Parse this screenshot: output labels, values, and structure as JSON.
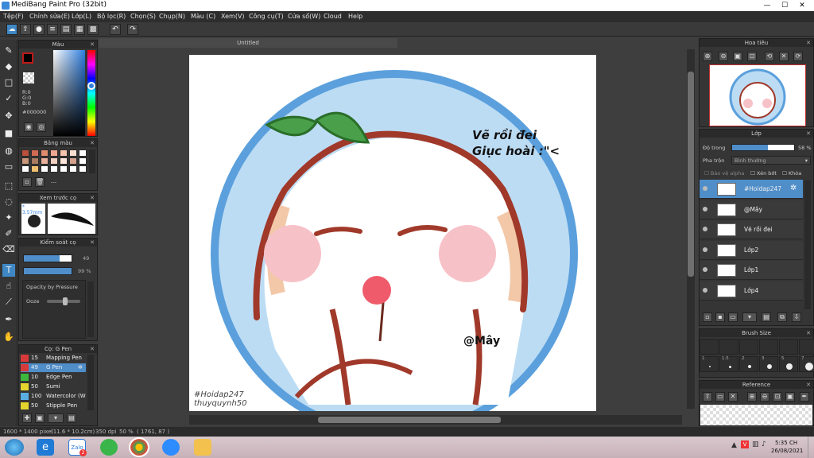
{
  "window": {
    "title": "MediBang Paint Pro (32bit)"
  },
  "menu": [
    "Tệp(F)",
    "Chỉnh sửa(E)",
    "Lớp(L)",
    "Bộ lọc(R)",
    "Chọn(S)",
    "Chụp(N)",
    "Màu (C)",
    "Xem(V)",
    "Công cụ(T)",
    "Cửa sổ(W)",
    "Cloud",
    "Help"
  ],
  "color_panel": {
    "title": "Màu",
    "r": "R:0",
    "g": "G:0",
    "b": "B:0",
    "hex": "#000000"
  },
  "palette_panel": {
    "title": "Bảng màu",
    "dashes": "---"
  },
  "preview_panel": {
    "title": "Xem trước cọ",
    "size": "* 3.57mm"
  },
  "brush_control": {
    "title": "Kiểm soát cọ",
    "size_value": "49",
    "opacity_value": "99 %",
    "pressure_label": "Opacity by Pressure",
    "ooze_label": "Ooze"
  },
  "brush_list": {
    "title": "Cọ: G Pen",
    "items": [
      {
        "size": "15",
        "name": "Mapping Pen",
        "color": "#d83a3a"
      },
      {
        "size": "49",
        "name": "G Pen",
        "color": "#d83a3a",
        "selected": true
      },
      {
        "size": "10",
        "name": "Edge Pen",
        "color": "#3db83d"
      },
      {
        "size": "50",
        "name": "Sumi",
        "color": "#e3d52e"
      },
      {
        "size": "100",
        "name": "Watercolor (W",
        "color": "#5aaee3"
      },
      {
        "size": "50",
        "name": "Stipple Pen",
        "color": "#e3d52e"
      }
    ]
  },
  "document": {
    "tab": "Untitled"
  },
  "artwork": {
    "text_main": [
      "Vẽ rồi đei",
      "Giục hoài :\"<"
    ],
    "signature": "@Mây",
    "watermark": [
      "#Hoidap247",
      "thuyquynh50"
    ]
  },
  "navigator": {
    "title": "Hoa tiêu"
  },
  "layers": {
    "title": "Lớp",
    "opacity_label": "Độ trong",
    "opacity_value": "58 %",
    "blend_label": "Pha trộn",
    "blend_value": "Bình thường",
    "protect_alpha": "Bảo vệ alpha",
    "clipping": "Xén bớt",
    "lock": "Khóa",
    "items": [
      {
        "name": "#Hoidap247",
        "selected": true
      },
      {
        "name": "@Mây"
      },
      {
        "name": "Vẽ rồi đei"
      },
      {
        "name": "Lớp2"
      },
      {
        "name": "Lớp1"
      },
      {
        "name": "Lớp4"
      }
    ]
  },
  "brush_size": {
    "title": "Brush Size",
    "values": [
      "1",
      "1.5",
      "2",
      "3",
      "5",
      "7"
    ]
  },
  "reference": {
    "title": "Reference"
  },
  "status": {
    "size": "1600 * 1400 pixel",
    "physical": "(11.6 * 10.2cm)",
    "dpi": "350 dpi",
    "zoom": "50 %",
    "coords": "( 1761, 87 )"
  },
  "taskbar": {
    "time": "5:35 CH",
    "date": "26/08/2021",
    "zalo_badge": "2"
  },
  "colors": {
    "accent": "#4f8ec9",
    "bg": "#3c3c3c",
    "panel": "#353535",
    "art_blue": "#5ba0dc",
    "art_brown": "#a0392a"
  }
}
